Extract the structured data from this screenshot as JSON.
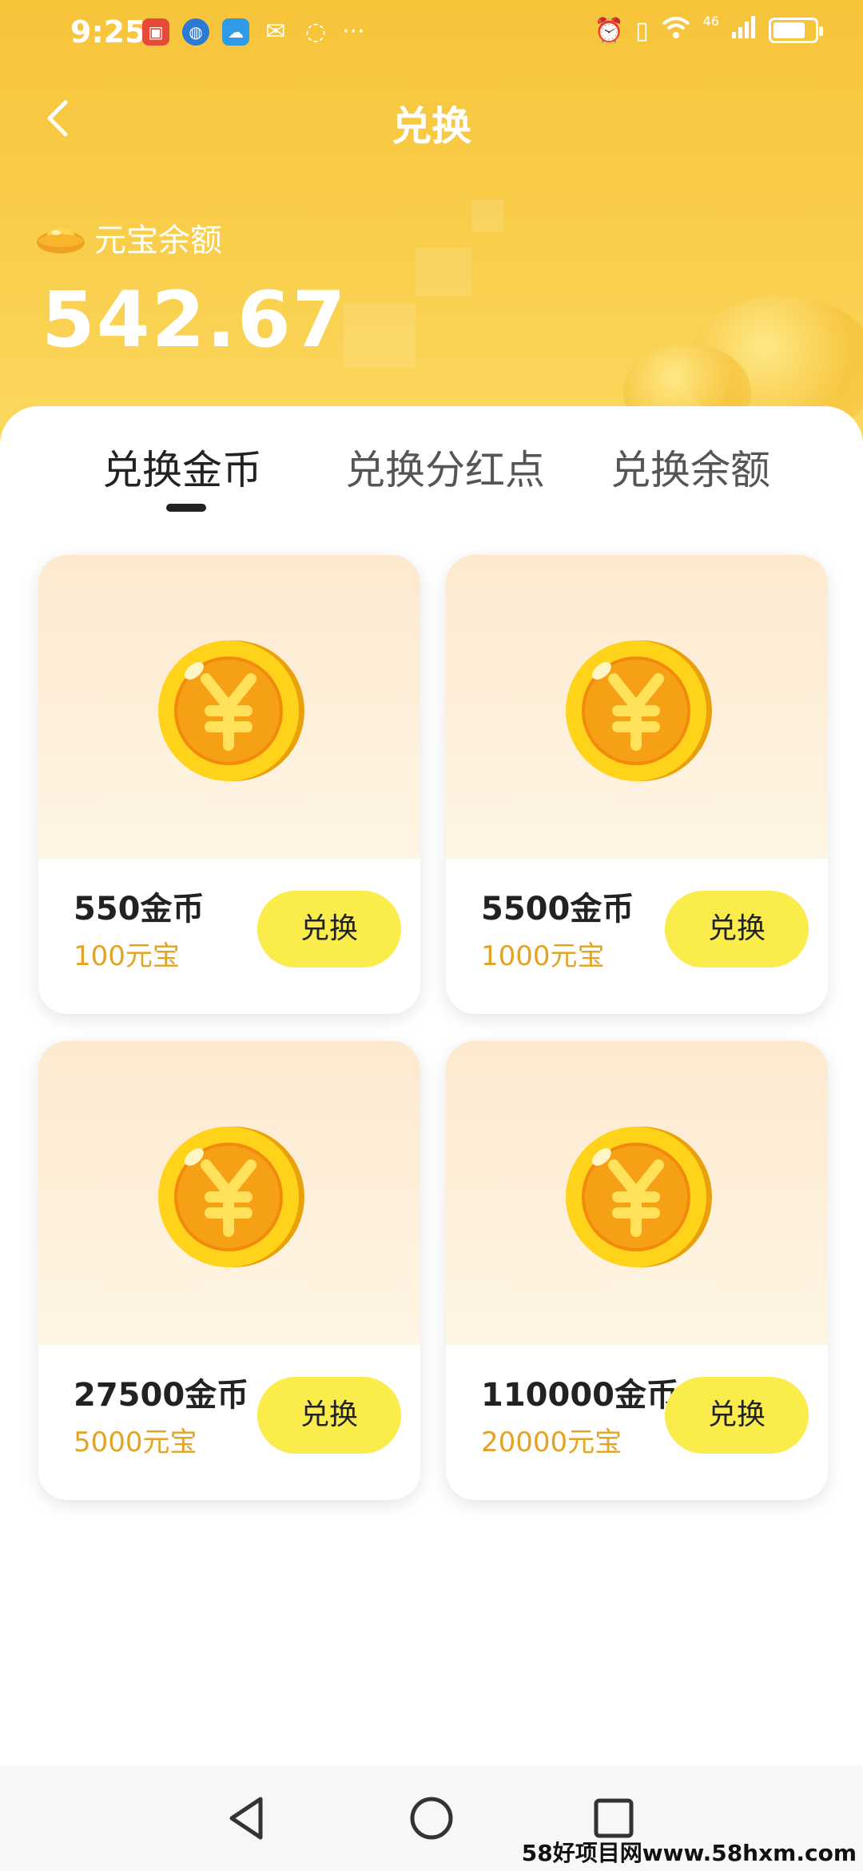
{
  "status_bar": {
    "time": "9:25",
    "network": "46",
    "more": "···"
  },
  "header": {
    "title": "兑换",
    "balance_label": "元宝余额",
    "balance_value": "542.67"
  },
  "tabs": [
    {
      "label": "兑换金币",
      "active": true
    },
    {
      "label": "兑换分红点",
      "active": false
    },
    {
      "label": "兑换余额",
      "active": false
    }
  ],
  "products": [
    {
      "name": "550金币",
      "price": "100元宝",
      "button": "兑换"
    },
    {
      "name": "5500金币",
      "price": "1000元宝",
      "button": "兑换"
    },
    {
      "name": "27500金币",
      "price": "5000元宝",
      "button": "兑换"
    },
    {
      "name": "110000金币",
      "price": "20000元宝",
      "button": "兑换"
    }
  ],
  "watermark": "58好项目网www.58hxm.com",
  "colors": {
    "header_yellow": "#f7c43a",
    "button_yellow": "#f9ec4b",
    "price_orange": "#e3a323"
  },
  "icons": {
    "back": "chevron-left-icon",
    "balance": "gold-ingot-icon",
    "product": "yuan-coin-icon",
    "nav_back": "triangle-back-icon",
    "nav_home": "circle-home-icon",
    "nav_recent": "square-recent-icon"
  }
}
